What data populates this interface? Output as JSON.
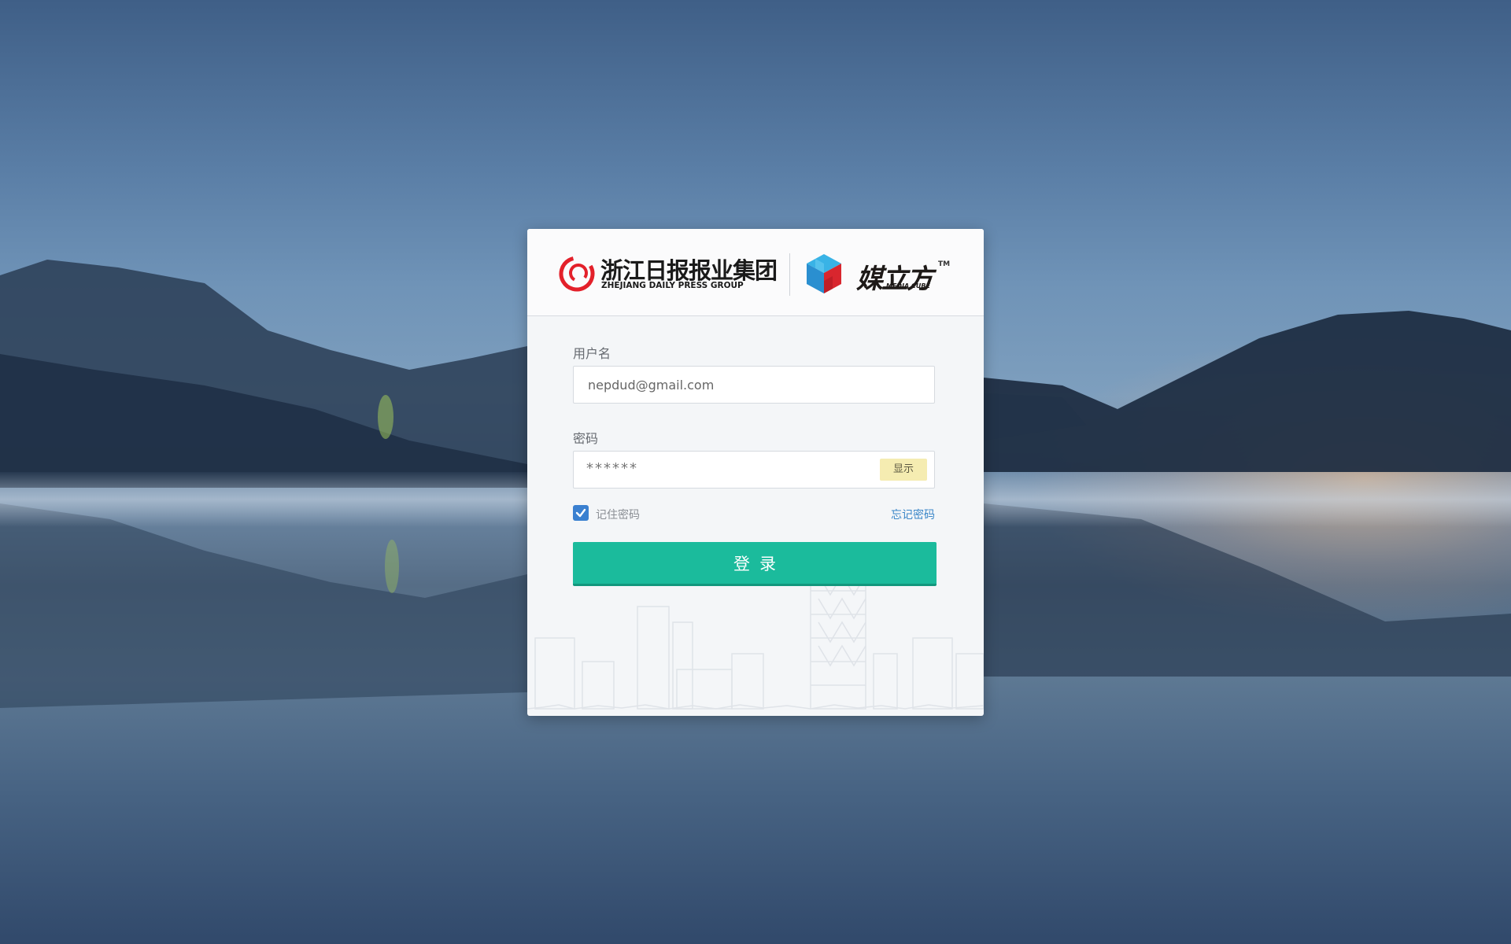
{
  "brand": {
    "group_name": "浙江日报报业集团",
    "group_name_en": "ZHEJIANG DAILY PRESS GROUP",
    "product_name": "媒立方",
    "product_name_en": "MEDIA CUBE",
    "trademark": "TM",
    "logo_color": "#e3202a"
  },
  "form": {
    "username_label": "用户名",
    "username_value": "nepdud@gmail.com",
    "password_label": "密码",
    "password_value": "******",
    "show_password_label": "显示",
    "remember_label": "记住密码",
    "remember_checked": true,
    "forgot_label": "忘记密码",
    "login_label": "登录"
  },
  "colors": {
    "primary_button": "#1bbb9c",
    "link": "#3a86c8",
    "checkbox": "#3a80d0",
    "show_button": "#f5ecb1"
  }
}
